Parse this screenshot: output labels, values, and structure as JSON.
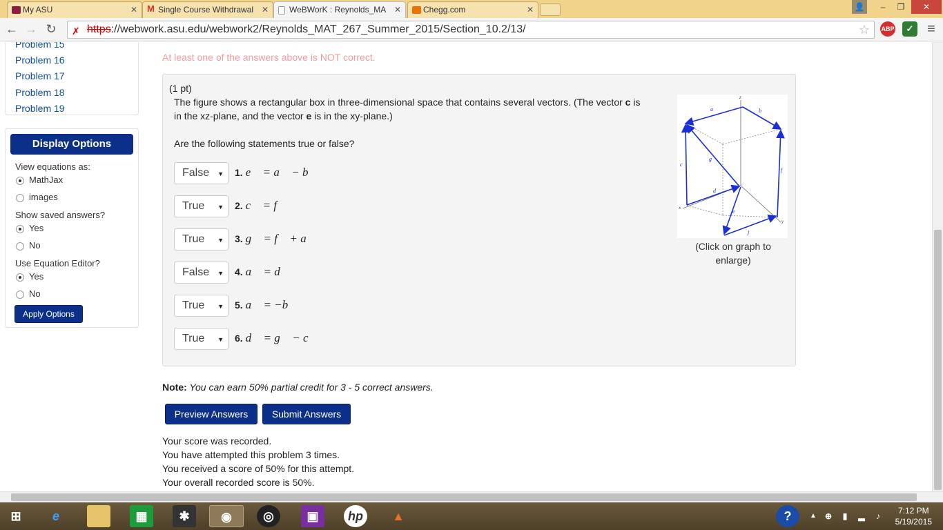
{
  "browser": {
    "tabs": [
      {
        "label": "My ASU",
        "favicon_color": "#8c1d40"
      },
      {
        "label": "Single Course Withdrawal",
        "favicon_color": "#d93025"
      },
      {
        "label": "WeBWorK : Reynolds_MA",
        "favicon_color": "#ffffff"
      },
      {
        "label": "Chegg.com",
        "favicon_color": "#eb7100"
      }
    ],
    "url_scheme": "https",
    "url_rest": "://webwork.asu.edu/webwork2/Reynolds_MAT_267_Summer_2015/Section_10.2/13/",
    "ext_abp": "ABP"
  },
  "sidebar": {
    "problems": [
      "Problem 15",
      "Problem 16",
      "Problem 17",
      "Problem 18",
      "Problem 19"
    ],
    "display_options_title": "Display Options",
    "view_equations_label": "View equations as:",
    "view_equations_options": [
      "MathJax",
      "images"
    ],
    "saved_answers_label": "Show saved answers?",
    "saved_answers_options": [
      "Yes",
      "No"
    ],
    "equation_editor_label": "Use Equation Editor?",
    "equation_editor_options": [
      "Yes",
      "No"
    ],
    "apply_button": "Apply Options"
  },
  "main": {
    "warning": "At least one of the answers above is NOT correct.",
    "points": "(1 pt)",
    "description_line1_a": "The figure shows a rectangular box in three-dimensional space that contains several vectors. (The vector ",
    "description_c": "c",
    "description_line1_b": " is",
    "description_line2_a": "in the xz-plane, and the vector ",
    "description_e": "e",
    "description_line2_b": " is in the xy-plane.)",
    "question": "Are the following statements true or false?",
    "statements": [
      {
        "answer": "False",
        "number": "1.",
        "math": "e⃗ = a⃗ − b⃗"
      },
      {
        "answer": "True",
        "number": "2.",
        "math": "c⃗ = f⃗"
      },
      {
        "answer": "True",
        "number": "3.",
        "math": "g⃗ = f⃗ + a⃗"
      },
      {
        "answer": "False",
        "number": "4.",
        "math": "a⃗ = d⃗"
      },
      {
        "answer": "True",
        "number": "5.",
        "math": "a⃗ = −b⃗"
      },
      {
        "answer": "True",
        "number": "6.",
        "math": "d⃗ = g⃗ − c⃗"
      }
    ],
    "figure_caption": "(Click on graph to enlarge)",
    "note_label": "Note:",
    "note_text": " You can earn 50% partial credit for 3 - 5 correct answers.",
    "preview_button": "Preview Answers",
    "submit_button": "Submit Answers",
    "score_lines": [
      "Your score was recorded.",
      "You have attempted this problem 3 times.",
      "You received a score of 50% for this attempt.",
      "Your overall recorded score is 50%."
    ]
  },
  "taskbar": {
    "time": "7:12 PM",
    "date": "5/19/2015"
  }
}
